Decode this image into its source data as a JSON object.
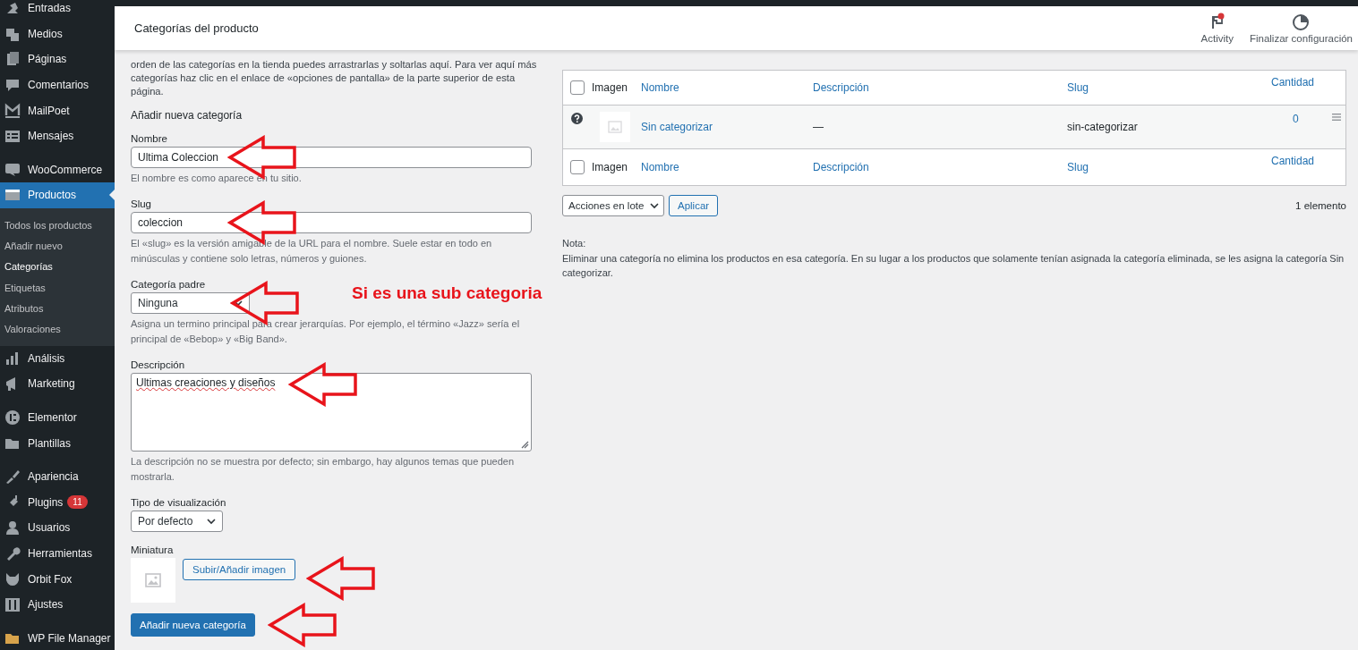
{
  "sidebar": {
    "groups": [
      {
        "items": [
          {
            "label": "Entradas",
            "selected": false
          },
          {
            "label": "Medios",
            "selected": false
          },
          {
            "label": "Páginas",
            "selected": false
          },
          {
            "label": "Comentarios",
            "selected": false
          },
          {
            "label": "MailPoet",
            "selected": false
          },
          {
            "label": "Mensajes",
            "selected": false
          }
        ]
      },
      {
        "items": [
          {
            "label": "WooCommerce",
            "selected": false
          },
          {
            "label": "Productos",
            "selected": true,
            "children": [
              {
                "label": "Todos los productos",
                "selected": false
              },
              {
                "label": "Añadir nuevo",
                "selected": false
              },
              {
                "label": "Categorías",
                "selected": true
              },
              {
                "label": "Etiquetas",
                "selected": false
              },
              {
                "label": "Atributos",
                "selected": false
              },
              {
                "label": "Valoraciones",
                "selected": false
              }
            ]
          }
        ]
      },
      {
        "items": [
          {
            "label": "Análisis",
            "selected": false
          },
          {
            "label": "Marketing",
            "selected": false
          }
        ]
      },
      {
        "items": [
          {
            "label": "Elementor",
            "selected": false
          },
          {
            "label": "Plantillas",
            "selected": false
          }
        ]
      },
      {
        "items": [
          {
            "label": "Apariencia",
            "selected": false
          },
          {
            "label": "Plugins",
            "selected": false,
            "badge": "11"
          },
          {
            "label": "Usuarios",
            "selected": false
          },
          {
            "label": "Herramientas",
            "selected": false
          },
          {
            "label": "Orbit Fox",
            "selected": false
          },
          {
            "label": "Ajustes",
            "selected": false
          }
        ]
      },
      {
        "items": [
          {
            "label": "WP File Manager",
            "selected": false
          }
        ]
      }
    ]
  },
  "header": {
    "title": "Categorías del producto",
    "actions": [
      {
        "label": "Activity",
        "has_notification": true
      },
      {
        "label": "Finalizar configuración",
        "has_notification": false
      }
    ]
  },
  "form": {
    "intro": "orden de las categorías en la tienda puedes arrastrarlas y soltarlas aquí. Para ver aquí más categorías haz clic en el enlace de «opciones de pantalla» de la parte superior de esta página.",
    "heading": "Añadir nueva categoría",
    "fields": [
      {
        "kind": "text",
        "label": "Nombre",
        "value": "Ultima Coleccion",
        "help": "El nombre es como aparece en tu sitio.",
        "arrow": true
      },
      {
        "kind": "text",
        "label": "Slug",
        "value": "coleccion",
        "help": "El «slug» es la versión amigable de la URL para el nombre. Suele estar en todo en minúsculas y contiene solo letras, números y guiones.",
        "arrow": true
      },
      {
        "kind": "select",
        "label": "Categoría padre",
        "value": "Ninguna",
        "help": "Asigna un termino principal para crear jerarquías. Por ejemplo, el término «Jazz» sería el principal de «Bebop» y «Big Band».",
        "arrow": true,
        "note": "Si es una sub categoria"
      },
      {
        "kind": "textarea",
        "label": "Descripción",
        "value": "Ultimas creaciones y diseños",
        "help": "La descripción no se muestra por defecto; sin embargo, hay algunos temas que pueden mostrarla.",
        "arrow": true
      },
      {
        "kind": "select",
        "label": "Tipo de visualización",
        "value": "Por defecto",
        "arrow": false
      },
      {
        "kind": "image",
        "label": "Miniatura",
        "button": "Subir/Añadir imagen",
        "arrow": true
      }
    ],
    "submit": {
      "label": "Añadir nueva categoría",
      "arrow": true
    }
  },
  "table": {
    "select_all_checked": false,
    "columns": [
      {
        "label": "Imagen",
        "sortable": false
      },
      {
        "label": "Nombre",
        "sortable": true
      },
      {
        "label": "Descripción",
        "sortable": true
      },
      {
        "label": "Slug",
        "sortable": true
      },
      {
        "label": "Cantidad",
        "sortable": true
      }
    ],
    "rows": [
      {
        "default": true,
        "name": "Sin categorizar",
        "description": "—",
        "slug": "sin-categorizar",
        "count": "0"
      }
    ],
    "footer_columns": [
      {
        "label": "Imagen",
        "sortable": false
      },
      {
        "label": "Nombre",
        "sortable": true
      },
      {
        "label": "Descripción",
        "sortable": true
      },
      {
        "label": "Slug",
        "sortable": true
      },
      {
        "label": "Cantidad",
        "sortable": true
      }
    ]
  },
  "table_bottom": {
    "bulk_action": "Acciones en lote",
    "apply": "Aplicar",
    "count": "1 elemento"
  },
  "note": {
    "title": "Nota:",
    "text": "Eliminar una categoría no elimina los productos en esa categoría. En su lugar a los productos que solamente tenían asignada la categoría eliminada, se les asigna la categoría Sin categorizar."
  }
}
